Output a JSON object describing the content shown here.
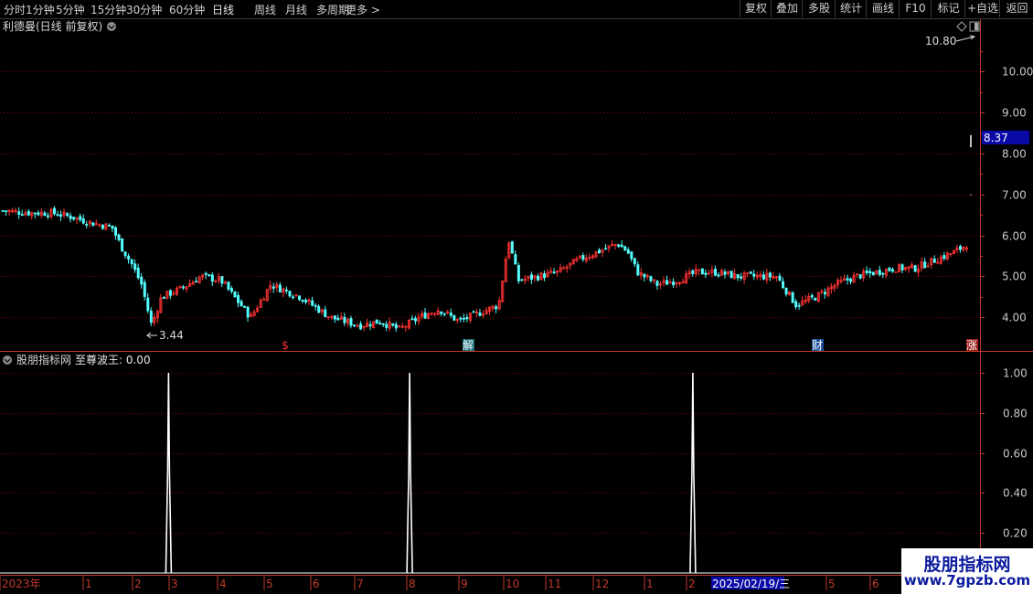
{
  "toolbar": {
    "periods": [
      "分时",
      "1分钟",
      "5分钟",
      "15分钟",
      "30分钟",
      "60分钟",
      "日线",
      "周线",
      "月线",
      "多周期",
      "更多 >"
    ],
    "active_period": "日线",
    "right_buttons": [
      "复权",
      "叠加",
      "多股",
      "统计",
      "画线",
      "F10",
      "标记",
      "+自选",
      "返回"
    ]
  },
  "main_panel": {
    "title": "利德曼(日线 前复权)",
    "high_label": "10.80",
    "low_label": "3.44",
    "last_price": "8.37",
    "y_ticks": [
      "10.00",
      "9.00",
      "8.00",
      "7.00",
      "6.00",
      "5.00",
      "4.00"
    ],
    "markers": [
      {
        "label": "$",
        "color": "#ff3030",
        "bg": ""
      },
      {
        "label": "解",
        "color": "#ffffff",
        "bg": "#1b6f7a"
      },
      {
        "label": "财",
        "color": "#ffffff",
        "bg": "#1b4f9a"
      },
      {
        "label": "涨",
        "color": "#ffffff",
        "bg": "#a02020"
      }
    ]
  },
  "indicator_panel": {
    "title": "股朋指标网",
    "indicator_label": "至尊波王: 0.00",
    "y_ticks": [
      "1.00",
      "0.80",
      "0.60",
      "0.40",
      "0.20"
    ]
  },
  "x_axis": {
    "labels": [
      "2023年",
      "1",
      "2",
      "3",
      "4",
      "5",
      "6",
      "7",
      "8",
      "9",
      "10",
      "11",
      "12",
      "1",
      "2",
      "5",
      "6"
    ],
    "cursor_date": "2025/02/19/三"
  },
  "watermark": {
    "line1": "股朋指标网",
    "line2": "www.7gpzb.com"
  },
  "colors": {
    "up": "#ff3232",
    "down": "#54ffff",
    "grid": "#8b0000",
    "axis": "#c0392b",
    "cursor_bg": "#0a0aa8"
  },
  "chart_data": [
    {
      "type": "candlestick",
      "title": "利德曼(日线 前复权)",
      "ylim": [
        3.2,
        10.9
      ],
      "close_path": [
        {
          "x": 0,
          "y": 6.6
        },
        {
          "x": 0.03,
          "y": 6.55
        },
        {
          "x": 0.05,
          "y": 6.55
        },
        {
          "x": 0.07,
          "y": 6.45
        },
        {
          "x": 0.09,
          "y": 6.3
        },
        {
          "x": 0.11,
          "y": 6.2
        },
        {
          "x": 0.12,
          "y": 5.7
        },
        {
          "x": 0.13,
          "y": 5.3
        },
        {
          "x": 0.14,
          "y": 4.8
        },
        {
          "x": 0.15,
          "y": 3.8
        },
        {
          "x": 0.16,
          "y": 4.5
        },
        {
          "x": 0.18,
          "y": 4.7
        },
        {
          "x": 0.2,
          "y": 5.0
        },
        {
          "x": 0.22,
          "y": 4.9
        },
        {
          "x": 0.24,
          "y": 4.3
        },
        {
          "x": 0.25,
          "y": 4.0
        },
        {
          "x": 0.27,
          "y": 4.8
        },
        {
          "x": 0.3,
          "y": 4.5
        },
        {
          "x": 0.33,
          "y": 4.0
        },
        {
          "x": 0.36,
          "y": 3.8
        },
        {
          "x": 0.38,
          "y": 3.9
        },
        {
          "x": 0.4,
          "y": 3.7
        },
        {
          "x": 0.42,
          "y": 4.0
        },
        {
          "x": 0.44,
          "y": 4.2
        },
        {
          "x": 0.46,
          "y": 3.9
        },
        {
          "x": 0.48,
          "y": 4.1
        },
        {
          "x": 0.5,
          "y": 4.3
        },
        {
          "x": 0.51,
          "y": 5.9
        },
        {
          "x": 0.52,
          "y": 4.9
        },
        {
          "x": 0.54,
          "y": 5.0
        },
        {
          "x": 0.56,
          "y": 5.1
        },
        {
          "x": 0.58,
          "y": 5.4
        },
        {
          "x": 0.6,
          "y": 5.6
        },
        {
          "x": 0.62,
          "y": 5.8
        },
        {
          "x": 0.63,
          "y": 5.6
        },
        {
          "x": 0.64,
          "y": 5.1
        },
        {
          "x": 0.66,
          "y": 4.8
        },
        {
          "x": 0.68,
          "y": 4.9
        },
        {
          "x": 0.7,
          "y": 5.1
        },
        {
          "x": 0.72,
          "y": 5.1
        },
        {
          "x": 0.74,
          "y": 5.0
        },
        {
          "x": 0.76,
          "y": 5.0
        },
        {
          "x": 0.78,
          "y": 5.0
        },
        {
          "x": 0.8,
          "y": 4.3
        },
        {
          "x": 0.82,
          "y": 4.5
        },
        {
          "x": 0.84,
          "y": 4.8
        },
        {
          "x": 0.86,
          "y": 5.0
        },
        {
          "x": 0.88,
          "y": 5.1
        },
        {
          "x": 0.9,
          "y": 5.2
        },
        {
          "x": 0.92,
          "y": 5.2
        },
        {
          "x": 0.94,
          "y": 5.4
        },
        {
          "x": 0.96,
          "y": 5.6
        },
        {
          "x": 0.98,
          "y": 5.9
        },
        {
          "x": 0.985,
          "y": 8.37
        }
      ]
    },
    {
      "type": "line",
      "title": "至尊波王",
      "ylim": [
        0,
        1.05
      ],
      "spikes": [
        {
          "x": 0.172,
          "value": 1.0
        },
        {
          "x": 0.418,
          "value": 1.0
        },
        {
          "x": 0.707,
          "value": 1.0
        }
      ]
    }
  ]
}
